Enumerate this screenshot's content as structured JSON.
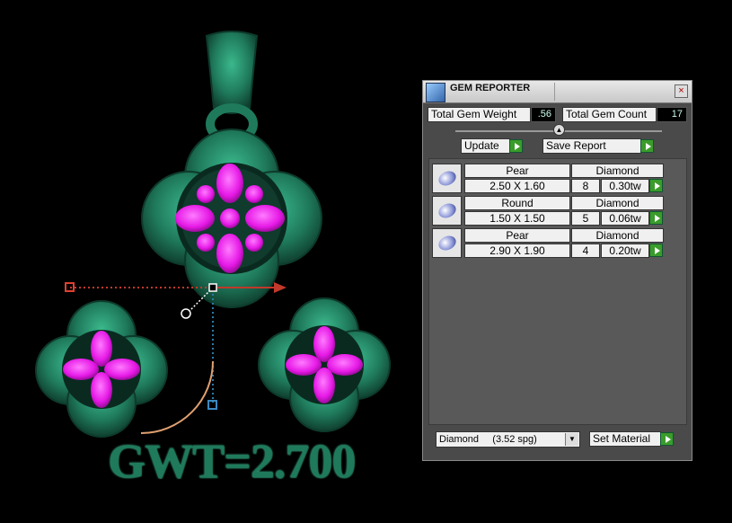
{
  "viewport": {
    "label": "GWT=2.700"
  },
  "panel": {
    "title": "GEM REPORTER",
    "close_symbol": "×",
    "total_gem_weight_label": "Total Gem Weight",
    "total_gem_weight_value": ".56",
    "total_gem_count_label": "Total Gem Count",
    "total_gem_count_value": "17",
    "update_label": "Update",
    "save_report_label": "Save Report",
    "gems": [
      {
        "shape": "Pear",
        "material": "Diamond",
        "size": "2.50 X 1.60",
        "count": "8",
        "weight": "0.30tw"
      },
      {
        "shape": "Round",
        "material": "Diamond",
        "size": "1.50 X 1.50",
        "count": "5",
        "weight": "0.06tw"
      },
      {
        "shape": "Pear",
        "material": "Diamond",
        "size": "2.90 X 1.90",
        "count": "4",
        "weight": "0.20tw"
      }
    ],
    "material_select": "Diamond     (3.52 spg)",
    "set_material_label": "Set Material"
  },
  "colors": {
    "metal": "#1f7a5c",
    "gem": "#e619e6",
    "panel_bg": "#4a4a4a",
    "play_button": "#3a9c2a"
  },
  "icons": [
    "gem-reporter-icon",
    "close-icon",
    "slider-knob-icon",
    "play-icon",
    "gem-thumbnail-icon",
    "dropdown-arrow-icon"
  ]
}
